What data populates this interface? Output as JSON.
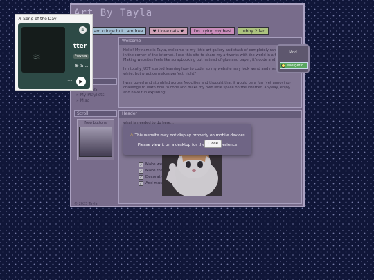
{
  "site": {
    "title": "Art By Tayla",
    "stamps": [
      "i am cringe but i am free",
      "♥ I love cats ♥",
      "i'm trying my best",
      "tubby 2 fan"
    ],
    "sidebar": {
      "links_head": "",
      "links": [
        "» Updates",
        "» My Playlists",
        "» Misc"
      ],
      "scroll_head": "Scroll",
      "new_buttons_label": "New buttons"
    },
    "welcome": {
      "head": "Welcome",
      "p1": "Hello! My name is Tayla, welcome to my little art gallery and stash of completely random stuff in the corner of the internet. I use this site to share my artworks with the world in a fun way. Making websites feels like scrapbooking but instead of glue and paper, it's code and gifs! XD",
      "p2": "I'm totally JUST started learning how to code, so my website may look weird and messy for a while, but practice makes perfect, right?",
      "p3": "I was bored and stumbled across Neocities and thought that it would be a fun (yet annoying) challenge to learn how to code and make my own little space on the internet, anyway, enjoy and have fun exploring!"
    },
    "header": {
      "head": "Header",
      "line": "what is needed to do here...",
      "todo": [
        "Make website look good",
        "Make the pages",
        "Decorations",
        "Add music"
      ]
    },
    "footer": "© 2023 Tayla"
  },
  "music": {
    "title": "Song of the Day",
    "track": "tter",
    "preview": "Preview",
    "add_label": "S...",
    "more": "···",
    "play": "▶",
    "spotify_icon": "spotify-icon"
  },
  "widget": {
    "title": "Mod",
    "button": "energetic"
  },
  "modal": {
    "warning_icon": "⚠",
    "text": "This website may not display properly on mobile devices. Please view it on a desktop for the best experience.",
    "close": "Close"
  },
  "colors": {
    "background": "#101638",
    "site_bg": "#8a7e9a",
    "player_bg": "#2d4a46",
    "modal_bg": "#6f6585"
  }
}
